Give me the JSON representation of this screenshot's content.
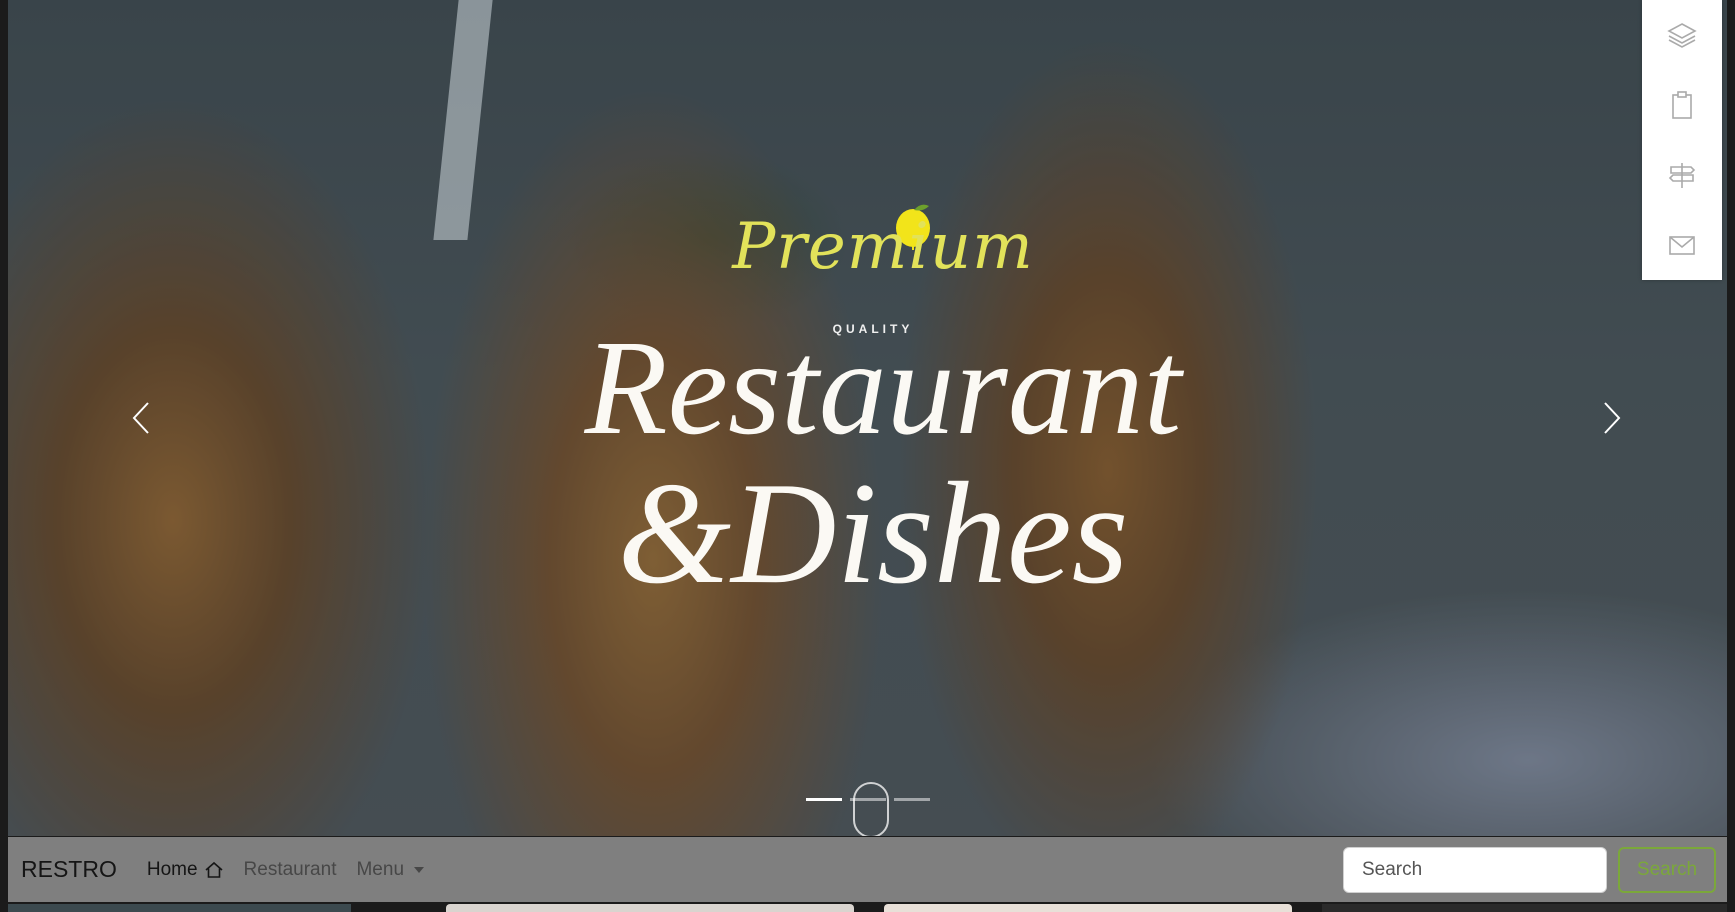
{
  "hero": {
    "premium": "Premium",
    "quality": "QUALITY",
    "headline_line1": "Restaurant",
    "headline_line2": "&Dishes",
    "prev_icon": "chevron-left-icon",
    "next_icon": "chevron-right-icon",
    "slide_count": 3,
    "active_slide": 1
  },
  "side_toolbar": {
    "icons": [
      "layers-icon",
      "clipboard-icon",
      "signpost-icon",
      "envelope-icon"
    ]
  },
  "navbar": {
    "brand": "RESTRO",
    "links": [
      {
        "label": "Home",
        "icon": "house-icon"
      },
      {
        "label": "Restaurant"
      },
      {
        "label": "Menu",
        "dropdown": true
      }
    ],
    "search_placeholder": "Search",
    "search_button": "Search"
  },
  "colors": {
    "accent": "#7ba83a",
    "premium_text": "#e2e25a",
    "navbar_bg": "#7f7f7f"
  }
}
